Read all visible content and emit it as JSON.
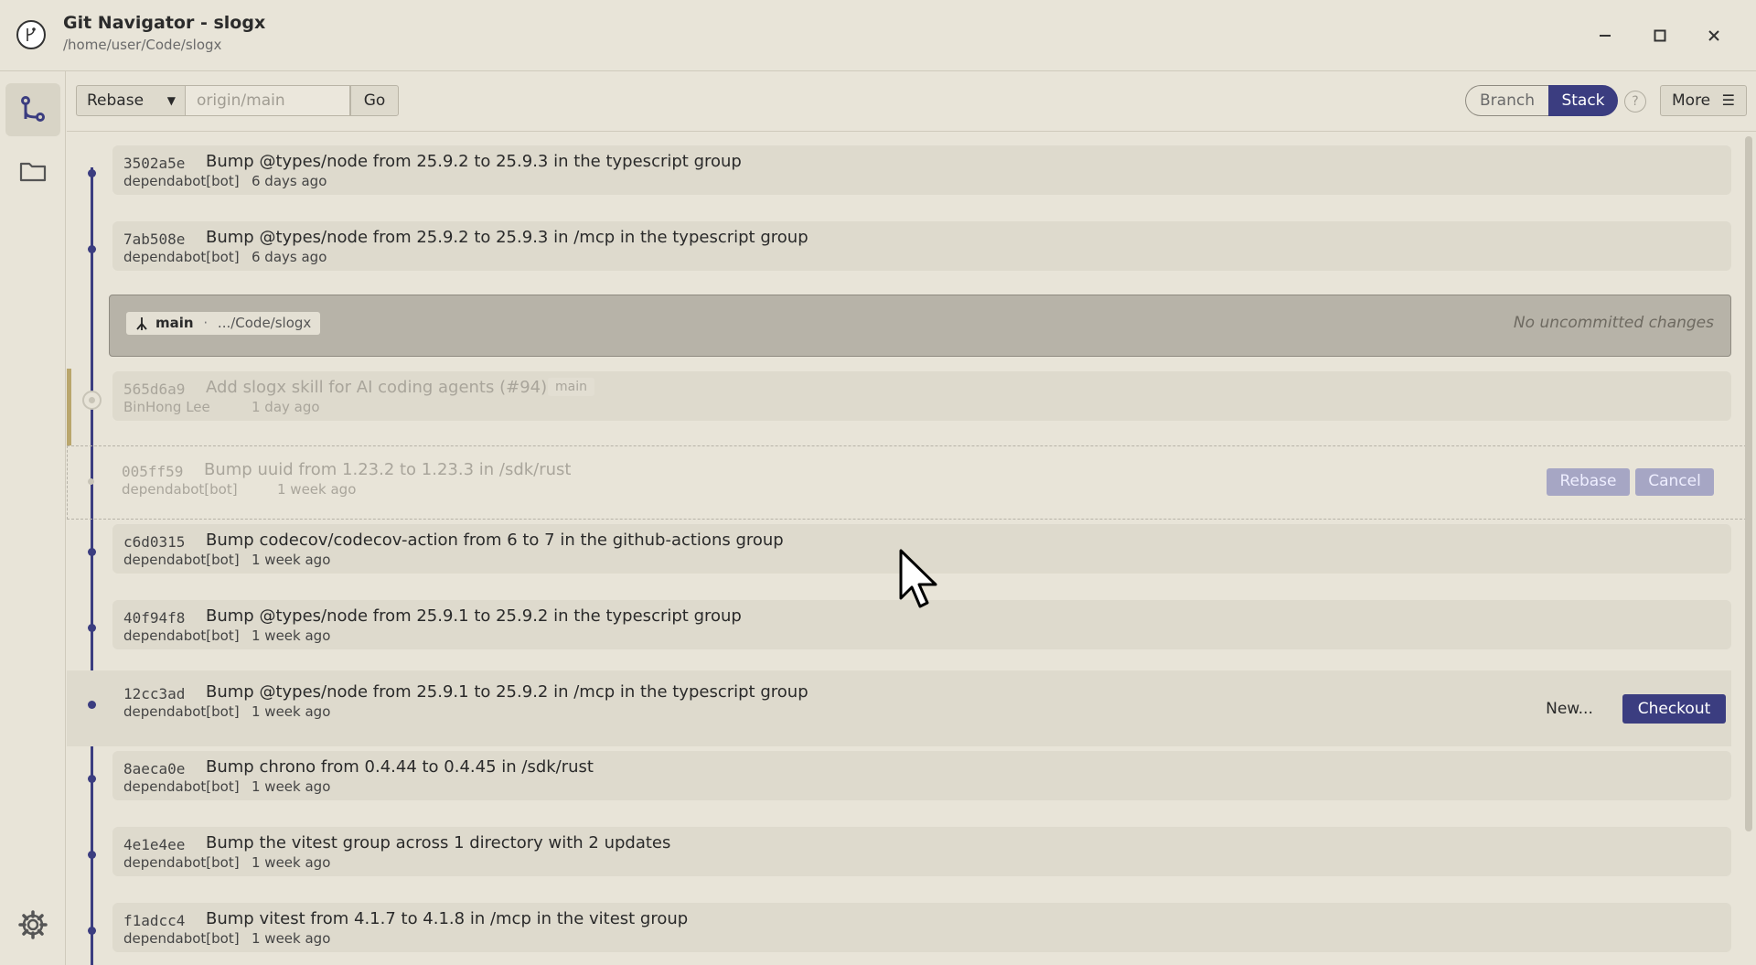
{
  "window": {
    "title": "Git Navigator - slogx",
    "path": "/home/user/Code/slogx"
  },
  "toolbar": {
    "mode_value": "Rebase",
    "target_placeholder": "origin/main",
    "go_label": "Go",
    "view_branch_label": "Branch",
    "view_stack_label": "Stack",
    "view_selected": "Stack",
    "help_label": "?",
    "more_label": "More"
  },
  "working_copy": {
    "branch": "main",
    "separator": "·",
    "path": ".../Code/slogx",
    "status": "No uncommitted changes"
  },
  "commits": [
    {
      "hash": "3502a5e",
      "message": "Bump @types/node from 25.9.2 to 25.9.3 in the typescript group",
      "author": "dependabot[bot]",
      "age": "6 days ago"
    },
    {
      "hash": "7ab508e",
      "message": "Bump @types/node from 25.9.2 to 25.9.3 in /mcp in the typescript group",
      "author": "dependabot[bot]",
      "age": "6 days ago"
    },
    {
      "hash": "565d6a9",
      "message": "Add slogx skill for AI coding agents (#94)",
      "author": "BinHong Lee",
      "age": "1 day ago",
      "branch_tag": "main"
    },
    {
      "hash": "005ff59",
      "message": "Bump uuid from 1.23.2 to 1.23.3 in /sdk/rust",
      "author": "dependabot[bot]",
      "age": "1 week ago"
    },
    {
      "hash": "c6d0315",
      "message": "Bump codecov/codecov-action from 6 to 7 in the github-actions group",
      "author": "dependabot[bot]",
      "age": "1 week ago"
    },
    {
      "hash": "40f94f8",
      "message": "Bump @types/node from 25.9.1 to 25.9.2 in the typescript group",
      "author": "dependabot[bot]",
      "age": "1 week ago"
    },
    {
      "hash": "12cc3ad",
      "message": "Bump @types/node from 25.9.1 to 25.9.2 in /mcp in the typescript group",
      "author": "dependabot[bot]",
      "age": "1 week ago"
    },
    {
      "hash": "8aeca0e",
      "message": "Bump chrono from 0.4.44 to 0.4.45 in /sdk/rust",
      "author": "dependabot[bot]",
      "age": "1 week ago"
    },
    {
      "hash": "4e1e4ee",
      "message": "Bump the vitest group across 1 directory with 2 updates",
      "author": "dependabot[bot]",
      "age": "1 week ago"
    },
    {
      "hash": "f1adcc4",
      "message": "Bump vitest from 4.1.7 to 4.1.8 in /mcp in the vitest group",
      "author": "dependabot[bot]",
      "age": "1 week ago"
    }
  ],
  "rebase_actions": {
    "rebase_label": "Rebase",
    "cancel_label": "Cancel"
  },
  "hover_actions": {
    "new_label": "New...",
    "checkout_label": "Checkout"
  },
  "colors": {
    "accent": "#3b3d80",
    "background": "#e8e4d8",
    "card": "#dedacd",
    "working_copy": "#b7b3a8"
  },
  "icons": [
    "app-logo-icon",
    "minimize-icon",
    "maximize-icon",
    "close-icon",
    "graph-icon",
    "folder-icon",
    "settings-gear-icon",
    "branch-icon"
  ]
}
